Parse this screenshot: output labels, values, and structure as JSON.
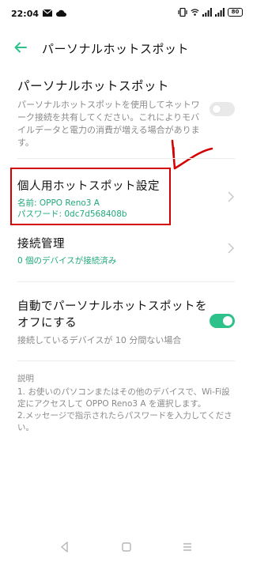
{
  "status": {
    "time": "22:04",
    "battery": "80",
    "network": "4G"
  },
  "header": {
    "title": "パーソナルホットスポット"
  },
  "hotspot": {
    "title": "パーソナルホットスポット",
    "description": [
      "パーソナルホットスポットを使用してネットワ",
      "ーク接続を共有してください。これによりモバ",
      "イルデータと電力の消費が増える場合がありま",
      "す。"
    ],
    "enabled": false
  },
  "settings": {
    "title": "個人用ホットスポット設定",
    "name_line": "名前: OPPO Reno3 A",
    "password_line": "パスワード: 0dc7d568408b"
  },
  "connections": {
    "title": "接続管理",
    "subtitle": "0 個のデバイスが接続済み"
  },
  "auto_off": {
    "title_line1": "自動でパーソナルホットスポットを",
    "title_line2": "オフにする",
    "subtitle": "接続しているデバイスが 10 分間ない場合",
    "enabled": true
  },
  "notes": {
    "heading": "説明",
    "lines": [
      "1. お使いのパソコンまたはその他のデバイスで、Wi-Fi設",
      "定にアクセスして OPPO Reno3 A を選択します。",
      "2.メッセージで指示されたらパスワードを入力してくださ",
      "い。"
    ]
  },
  "colors": {
    "accent": "#2dc28a",
    "link": "#1fa97a",
    "highlight": "#d40000"
  }
}
